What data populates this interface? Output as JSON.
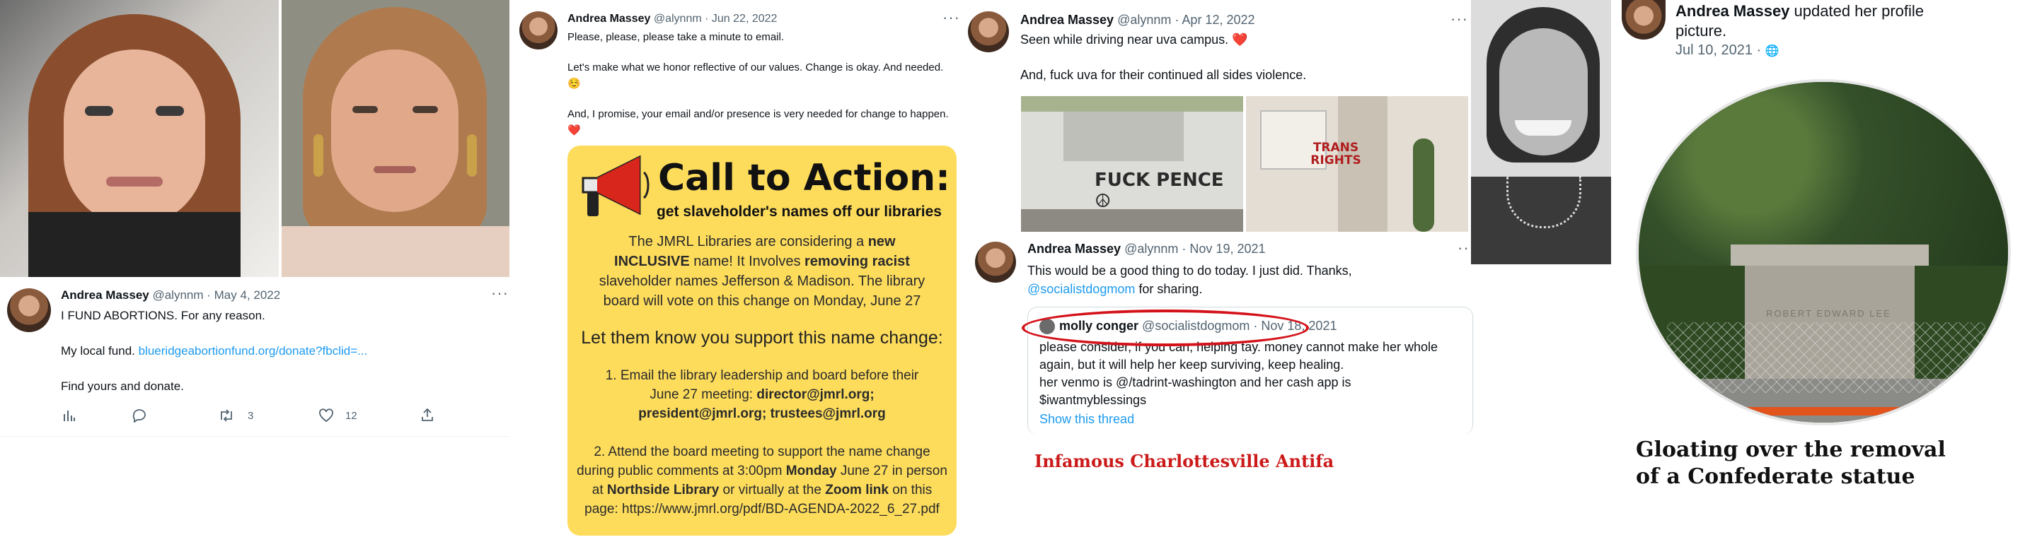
{
  "panel1": {
    "author": "Andrea Massey",
    "handle": "@alynnm",
    "date": "· May 4, 2022",
    "line1": "I FUND ABORTIONS. For any reason.",
    "line2_prefix": "My local fund.",
    "line2_link": "blueridgeabortionfund.org/donate?fbclid=...",
    "line3": "Find yours and donate.",
    "retweets": "3",
    "likes": "12",
    "menu": "···"
  },
  "panel2": {
    "author": "Andrea Massey",
    "handle": "@alynnm",
    "date": "· Jun 22, 2022",
    "menu": "···",
    "p1": "Please, please, please take a minute to email.",
    "p2": "Let's make what we honor reflective of our values. Change is okay. And needed. ☺️",
    "p3": "And, I promise, your email and/or presence is very needed for change to happen. ❤️",
    "cta": {
      "title": "Call to Action:",
      "subtitle": "get slaveholder's names off our libraries",
      "body_a": "The JMRL Libraries are considering a",
      "body_b": "new",
      "body_c": "INCLUSIVE",
      "body_d": "name! It Involves",
      "body_e": "removing racist",
      "body_f": "slaveholder names Jefferson & Madison. The library board will vote on this change on Monday, June 27",
      "heading": "Let them know you support this name change:",
      "step1_a": "1.   Email the library leadership and board before their June 27 meeting:",
      "step1_b": "director@jmrl.org; president@jmrl.org; trustees@jmrl.org",
      "step2_a": "2.   Attend the board meeting to support the name change during public comments at 3:00pm",
      "step2_b": "Monday",
      "step2_c": "June 27 in person at",
      "step2_d": "Northside Library",
      "step2_e": "or virtually at the",
      "step2_f": "Zoom link",
      "step2_g": "on this page: https://www.jmrl.org/pdf/BD-AGENDA-2022_6_27.pdf"
    }
  },
  "panel3": {
    "author": "Andrea Massey",
    "handle": "@alynnm",
    "date": "· Apr 12, 2022",
    "menu": "···",
    "line1": "Seen while driving near uva campus. ❤️",
    "line2": "And, fuck uva for their continued all sides violence.",
    "graffiti1": "FUCK PENCE ☮",
    "graffiti2": "TRANS RIGHTS",
    "reply": {
      "author": "Andrea Massey",
      "handle": "@alynnm",
      "date": "· Nov 19, 2021",
      "menu": "··",
      "text": "This would be a good thing to do today.  I just did.  Thanks,",
      "mention": "@socialistdogmom",
      "text_end": "for sharing."
    },
    "quote": {
      "author": "molly conger",
      "handle": "@socialistdogmom",
      "date": "· Nov 18, 2021",
      "l1": "please consider, if you can, helping tay. money cannot make her whole",
      "l2": "again, but it will help her keep surviving, keep healing.",
      "l3": "her venmo is @/tadrint-washington and her cash app is",
      "l4": "$iwantmyblessings",
      "show": "Show this thread"
    },
    "caption": "Infamous Charlottesville Antifa"
  },
  "panel4": {
    "author": "Andrea Massey",
    "action": "updated her profile picture.",
    "date": "Jul 10, 2021 · ",
    "globe": "🌐",
    "statue_text": "ROBERT EDWARD LEE",
    "caption": "Gloating over the removal of a Confederate statue"
  },
  "colors": {
    "link": "#1d9bf0",
    "cta_yellow": "#fddc5c",
    "caption_red": "#cc1a1a",
    "heart": "#e0245e"
  }
}
